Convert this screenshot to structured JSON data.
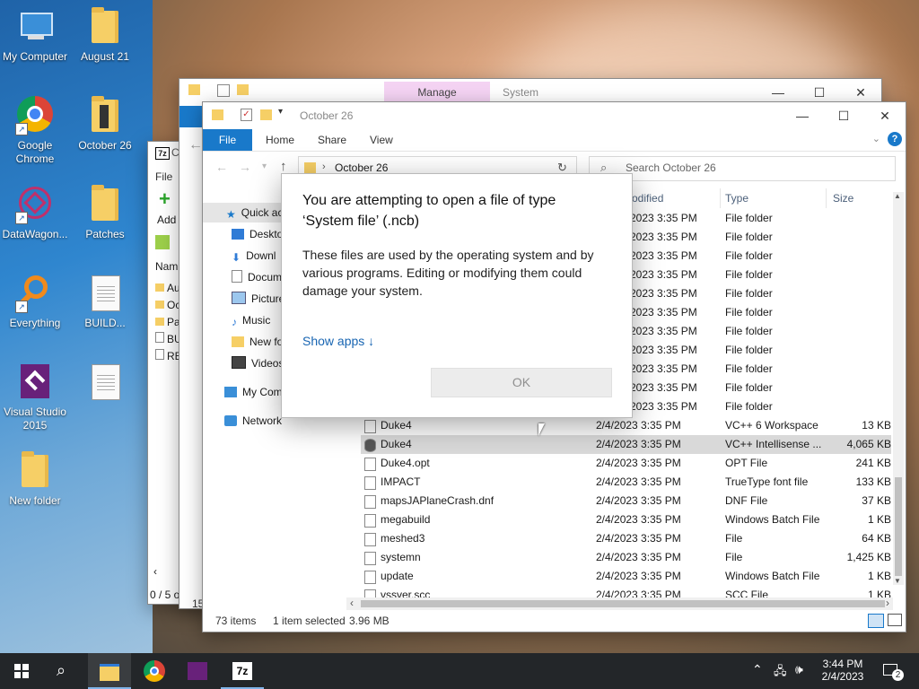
{
  "desktop": {
    "icons": [
      {
        "label": "My Computer"
      },
      {
        "label": "August 21"
      },
      {
        "label": "Google Chrome"
      },
      {
        "label": "October 26"
      },
      {
        "label": "DataWagon..."
      },
      {
        "label": "Patches"
      },
      {
        "label": "Everything"
      },
      {
        "label": "BUILD..."
      },
      {
        "label": "Visual Studio 2015"
      },
      {
        "label": "New folder"
      }
    ]
  },
  "back_window": {
    "manage_tab": "Manage",
    "system_tab": "System"
  },
  "sevenzip_window": {
    "title_char": "C",
    "file_menu": "File",
    "add_label": "Add",
    "name_header": "Nam",
    "rows": [
      "Au",
      "Oc",
      "Pa",
      "BU",
      "RE"
    ],
    "status": "0 / 5 o",
    "status_partial": "15"
  },
  "explorer": {
    "title": "October 26",
    "tabs": {
      "file": "File",
      "home": "Home",
      "share": "Share",
      "view": "View"
    },
    "address": {
      "crumb": "October 26"
    },
    "search": {
      "placeholder": "Search October 26"
    },
    "nav": {
      "quick_access": "Quick ac",
      "desktop": "Deskto",
      "downloads": "Downl",
      "documents": "Docum",
      "pictures": "Picture",
      "music": "Music",
      "new_folder": "New fo",
      "videos": "Videos",
      "my_computer": "My Com",
      "network": "Network"
    },
    "columns": {
      "modified": "odified",
      "type": "Type",
      "size": "Size"
    },
    "folder_rows": [
      {
        "date": "2023 3:35 PM",
        "type": "File folder"
      },
      {
        "date": "2023 3:35 PM",
        "type": "File folder"
      },
      {
        "date": "2023 3:35 PM",
        "type": "File folder"
      },
      {
        "date": "2023 3:35 PM",
        "type": "File folder"
      },
      {
        "date": "2023 3:35 PM",
        "type": "File folder"
      },
      {
        "date": "2023 3:35 PM",
        "type": "File folder"
      },
      {
        "date": "2023 3:35 PM",
        "type": "File folder"
      },
      {
        "date": "2023 3:35 PM",
        "type": "File folder"
      },
      {
        "date": "2023 3:35 PM",
        "type": "File folder"
      },
      {
        "date": "2023 3:35 PM",
        "type": "File folder"
      },
      {
        "date": "2023 3:35 PM",
        "type": "File folder"
      }
    ],
    "file_rows": [
      {
        "name": "Duke4",
        "date": "2/4/2023 3:35 PM",
        "type": "VC++ 6 Workspace",
        "size": "13 KB"
      },
      {
        "name": "Duke4",
        "date": "2/4/2023 3:35 PM",
        "type": "VC++ Intellisense ...",
        "size": "4,065 KB"
      },
      {
        "name": "Duke4.opt",
        "date": "2/4/2023 3:35 PM",
        "type": "OPT File",
        "size": "241 KB"
      },
      {
        "name": "IMPACT",
        "date": "2/4/2023 3:35 PM",
        "type": "TrueType font file",
        "size": "133 KB"
      },
      {
        "name": "mapsJAPlaneCrash.dnf",
        "date": "2/4/2023 3:35 PM",
        "type": "DNF File",
        "size": "37 KB"
      },
      {
        "name": "megabuild",
        "date": "2/4/2023 3:35 PM",
        "type": "Windows Batch File",
        "size": "1 KB"
      },
      {
        "name": "meshed3",
        "date": "2/4/2023 3:35 PM",
        "type": "File",
        "size": "64 KB"
      },
      {
        "name": "systemn",
        "date": "2/4/2023 3:35 PM",
        "type": "File",
        "size": "1,425 KB"
      },
      {
        "name": "update",
        "date": "2/4/2023 3:35 PM",
        "type": "Windows Batch File",
        "size": "1 KB"
      },
      {
        "name": "vssver.scc",
        "date": "2/4/2023 3:35 PM",
        "type": "SCC File",
        "size": "1 KB"
      }
    ],
    "status": {
      "count": "73 items",
      "selected": "1 item selected",
      "size": "3.96 MB"
    }
  },
  "dialog": {
    "title": "You are attempting to open a file of type ‘System file’ (.ncb)",
    "description": "These files are used by the operating system and by various programs. Editing or modifying them could damage your system.",
    "show_apps": "Show apps ↓",
    "ok": "OK"
  },
  "taskbar": {
    "time": "3:44 PM",
    "date": "2/4/2023",
    "notifications": "2"
  },
  "colors": {
    "accent": "#1979ca",
    "taskbar": "#232629",
    "link": "#1865b2"
  }
}
